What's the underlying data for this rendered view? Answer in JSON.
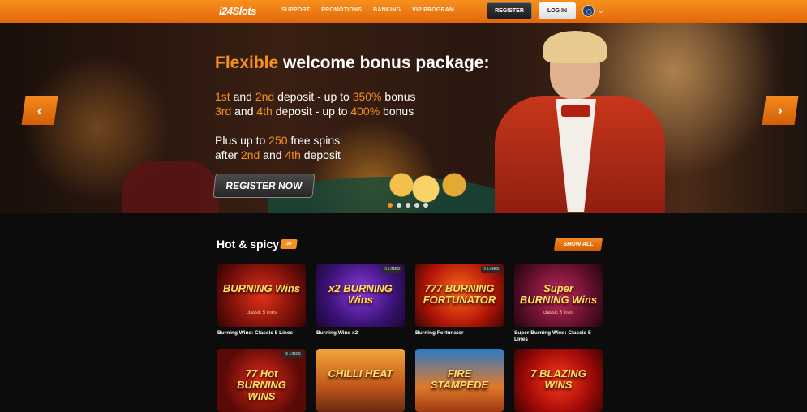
{
  "header": {
    "logo": "i24Slots",
    "nav": [
      "SUPPORT",
      "PROMOTIONS",
      "BANKING",
      "VIP PROGRAM"
    ],
    "register_label": "REGISTER",
    "login_label": "LOG IN",
    "language_icon": "eu-flag-icon"
  },
  "hero": {
    "title_highlight": "Flexible",
    "title_rest": " welcome bonus package:",
    "line1": {
      "a": "1st",
      "b": " and ",
      "c": "2nd",
      "d": " deposit - up to ",
      "e": "350%",
      "f": " bonus"
    },
    "line2": {
      "a": "3rd",
      "b": " and ",
      "c": "4th",
      "d": " deposit - up to ",
      "e": "400%",
      "f": " bonus"
    },
    "line3": {
      "a": "Plus up to ",
      "b": "250",
      "c": " free spins"
    },
    "line4": {
      "a": "after ",
      "b": "2nd",
      "c": " and ",
      "d": "4th",
      "e": " deposit"
    },
    "cta_label": "REGISTER NOW",
    "prev_icon": "chevron-left-icon",
    "next_icon": "chevron-right-icon",
    "slides_count": 5,
    "active_slide": 0
  },
  "section": {
    "title": "Hot & spicy",
    "badge": "30",
    "show_all_label": "SHOW ALL"
  },
  "games": [
    {
      "title": "BURNING Wins",
      "sub": "classic 5 lines",
      "caption": "Burning Wins: Classic 5 Lines",
      "lines": ""
    },
    {
      "title": "x2 BURNING Wins",
      "sub": "",
      "caption": "Burning Wins x2",
      "lines": "5 LINES"
    },
    {
      "title": "777 BURNING FORTUNATOR",
      "sub": "",
      "caption": "Burning Fortunator",
      "lines": "5 LINES"
    },
    {
      "title": "Super BURNING Wins",
      "sub": "classic 5 lines",
      "caption": "Super Burning Wins: Classic 5 Lines",
      "lines": ""
    },
    {
      "title": "77 Hot BURNING WINS",
      "sub": "",
      "caption": "",
      "lines": "5 LINES"
    },
    {
      "title": "CHILLI HEAT",
      "sub": "",
      "caption": "",
      "lines": ""
    },
    {
      "title": "FIRE STAMPEDE",
      "sub": "",
      "caption": "",
      "lines": ""
    },
    {
      "title": "7 BLAZING WINS",
      "sub": "",
      "caption": "",
      "lines": ""
    }
  ],
  "colors": {
    "accent": "#f7901f",
    "header_bg": "#e97712",
    "page_bg": "#0d0c0c"
  }
}
